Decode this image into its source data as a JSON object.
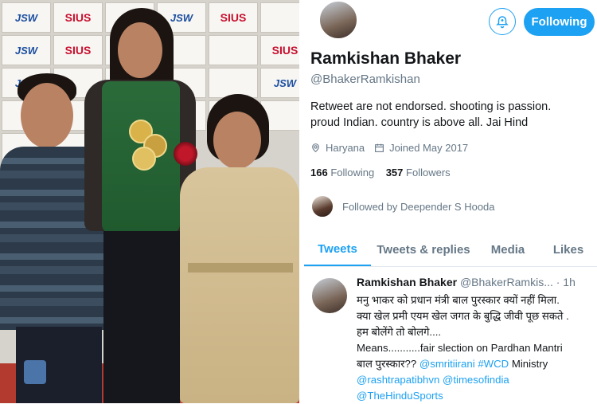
{
  "photo": {
    "tiles": [
      "JSW",
      "SIUS",
      "",
      "JSW",
      "SIUS",
      "",
      "JSW",
      "SIUS",
      "",
      "",
      "",
      "SIUS",
      "JSW",
      "",
      "",
      "",
      "",
      "JSW",
      "",
      "",
      "",
      "",
      "",
      "",
      "",
      ""
    ]
  },
  "profile": {
    "name": "Ramkishan Bhaker",
    "handle": "@BhakerRamkishan",
    "following_button": "Following",
    "bio": "Retweet are not endorsed. shooting is passion. proud Indian. country is above all. Jai Hind",
    "location": "Haryana",
    "joined": "Joined May 2017",
    "following_count": "166",
    "following_label": "Following",
    "followers_count": "357",
    "followers_label": "Followers",
    "followed_by": "Followed by Deepender S Hooda"
  },
  "tabs": [
    "Tweets",
    "Tweets & replies",
    "Media",
    "Likes"
  ],
  "tweet": {
    "name": "Ramkishan Bhaker",
    "handle_time": "@BhakerRamkis... · 1h",
    "line1": "मनु भाकर को प्रधान मंत्री बाल पुरस्कार क्यों नहीं मिला.",
    "line2": "क्या खेल प्रमी एयम खेल जगत के बुद्धि जीवी पूछ सकते .",
    "line3": "हम बोलेंगे तो बोलगे....",
    "line4": "Means...........fair slection on Pardhan Mantri",
    "line5a": "बाल पुरस्कार??",
    "mention1": "@smritiirani",
    "hashtag": "#WCD",
    "line5b": "Ministry",
    "mention2": "@rashtrapatibhvn",
    "mention3": "@timesofindia",
    "mention4": "@TheHinduSports"
  },
  "colors": {
    "accent": "#1da1f2",
    "muted": "#657786"
  }
}
